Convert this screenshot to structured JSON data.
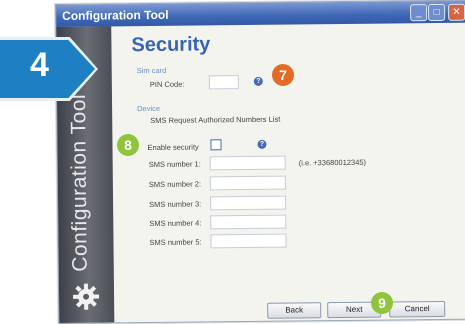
{
  "window": {
    "title": "Configuration Tool",
    "min_icon": "minimize-icon",
    "max_icon": "maximize-icon",
    "close_icon": "close-icon"
  },
  "sidebar": {
    "text": "Configuration Tool",
    "icon": "gear-icon"
  },
  "page": {
    "heading": "Security",
    "sim_section": "Sim card",
    "pin_label": "PIN Code:",
    "pin_value": "",
    "device_section": "Device",
    "sms_list_label": "SMS Request Authorized Numbers List",
    "enable_label": "Enable security",
    "enable_checked": false,
    "sms_fields": [
      {
        "label": "SMS number 1:",
        "value": ""
      },
      {
        "label": "SMS number 2:",
        "value": ""
      },
      {
        "label": "SMS number 3:",
        "value": ""
      },
      {
        "label": "SMS number 4:",
        "value": ""
      },
      {
        "label": "SMS number 5:",
        "value": ""
      }
    ],
    "sms_hint": "(i.e. +33680012345)"
  },
  "buttons": {
    "back": "Back",
    "next": "Next",
    "cancel": "Cancel"
  },
  "callouts": {
    "step4": "4",
    "step7": "7",
    "step8": "8",
    "step9": "9"
  },
  "colors": {
    "accent_blue": "#1e7fc3",
    "orange": "#e46a27",
    "green": "#8fc43c",
    "heading": "#3a63b3"
  }
}
